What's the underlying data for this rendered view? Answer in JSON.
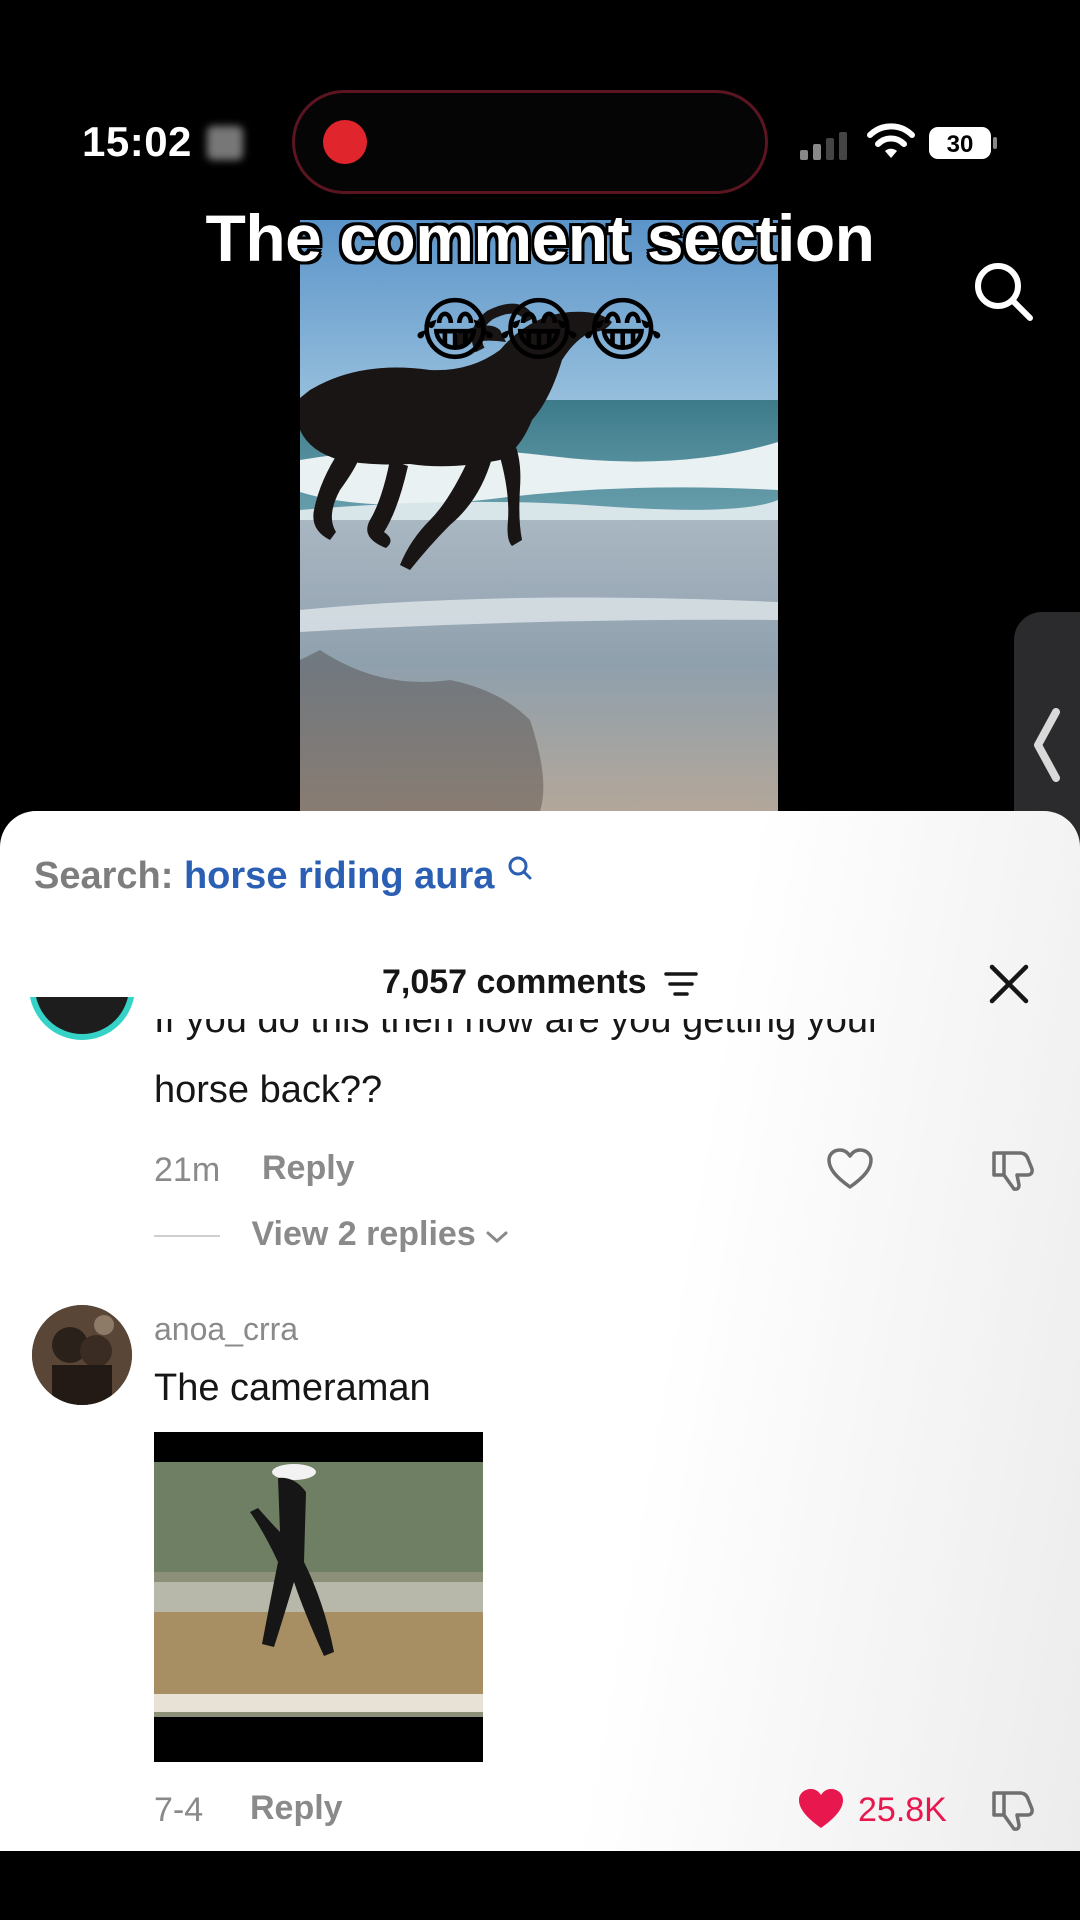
{
  "status_bar": {
    "time": "15:02",
    "battery": "30"
  },
  "video": {
    "overlay_title": "The comment section",
    "overlay_emoji": "😂😂😂"
  },
  "search": {
    "label": "Search:",
    "term": "horse riding aura"
  },
  "comments": {
    "count_label": "7,057 comments",
    "items": [
      {
        "partial_line": "If you do this then how are you getting your",
        "text": "horse back??",
        "time": "21m",
        "reply_label": "Reply",
        "view_replies": "View 2 replies"
      },
      {
        "username": "anoa_crra",
        "text": "The cameraman",
        "time": "7-4",
        "reply_label": "Reply",
        "likes": "25.8K",
        "liked": true
      }
    ]
  },
  "colors": {
    "accent_link": "#2a5fb3",
    "like_red": "#e8184f",
    "record_red": "#e0252c"
  }
}
